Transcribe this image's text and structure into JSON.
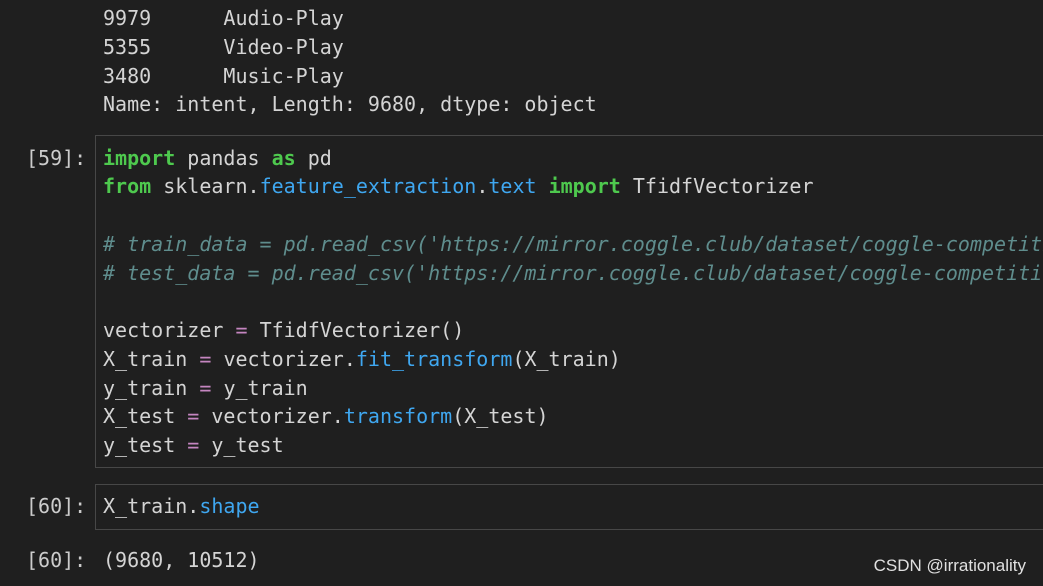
{
  "output_top": {
    "rows": [
      {
        "index": "9979",
        "value": "Audio-Play"
      },
      {
        "index": "5355",
        "value": "Video-Play"
      },
      {
        "index": "3480",
        "value": "Music-Play"
      }
    ],
    "summary": "Name: intent, Length: 9680, dtype: object"
  },
  "cell59": {
    "prompt": "[59]:",
    "line1": {
      "kw_import": "import",
      "mod": "pandas",
      "kw_as": "as",
      "alias": "pd"
    },
    "line2": {
      "kw_from": "from",
      "pkg": "sklearn",
      "dot1": ".",
      "sub1": "feature_extraction",
      "dot2": ".",
      "sub2": "text",
      "kw_import": "import",
      "cls": "TfidfVectorizer"
    },
    "comment1": "# train_data = pd.read_csv('https://mirror.coggle.club/dataset/coggle-competiti",
    "comment2": "# test_data = pd.read_csv('https://mirror.coggle.club/dataset/coggle-competiti",
    "line5": {
      "lhs": "vectorizer",
      "op": "=",
      "rhs": "TfidfVectorizer()"
    },
    "line6": {
      "lhs": "X_train",
      "op": "=",
      "obj": "vectorizer.",
      "method": "fit_transform",
      "args": "(X_train)"
    },
    "line7": {
      "lhs": "y_train",
      "op": "=",
      "rhs": "y_train"
    },
    "line8": {
      "lhs": "X_test",
      "op": "=",
      "obj": "vectorizer.",
      "method": "transform",
      "args": "(X_test)"
    },
    "line9": {
      "lhs": "y_test",
      "op": "=",
      "rhs": "y_test"
    }
  },
  "cell60": {
    "prompt": "[60]:",
    "obj": "X_train.",
    "attr": "shape",
    "out_prompt": "[60]:",
    "output": "(9680, 10512)"
  },
  "watermark": "CSDN @irrationality",
  "colors": {
    "background": "#1f1f1f",
    "keyword": "#4ec94e",
    "operator": "#c586c0",
    "attribute": "#3fa7f0",
    "comment": "#5f8d8d"
  }
}
